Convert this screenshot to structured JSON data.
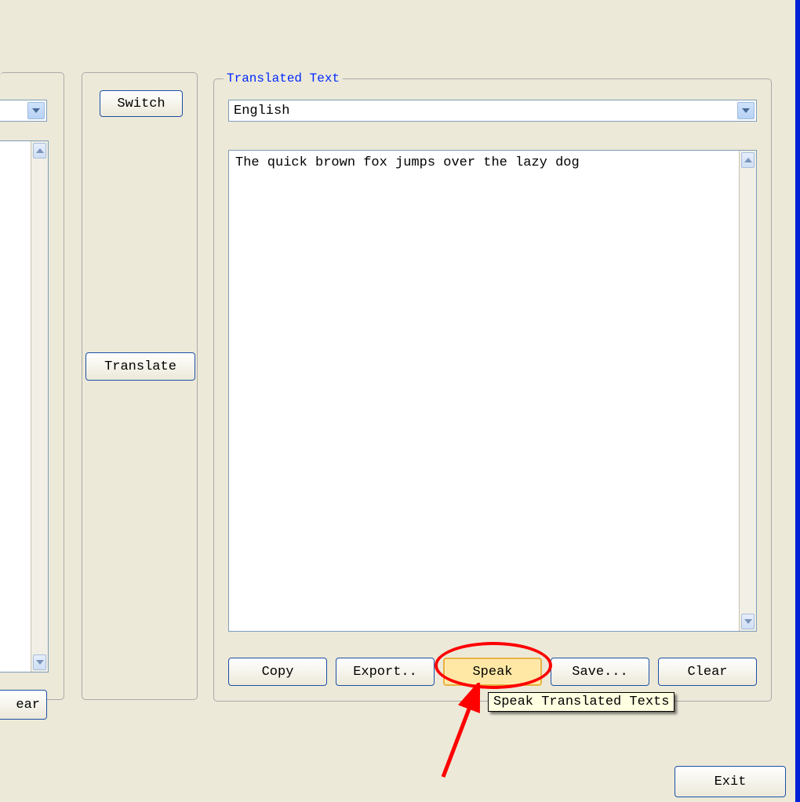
{
  "left": {
    "clear_fragment": "ear"
  },
  "mid": {
    "switch_label": "Switch",
    "translate_label": "Translate"
  },
  "right": {
    "legend": "Translated Text",
    "language": "English",
    "text": "The quick brown fox jumps over the lazy dog",
    "buttons": {
      "copy": "Copy",
      "export": "Export..",
      "speak": "Speak",
      "save": "Save...",
      "clear": "Clear"
    }
  },
  "tooltip": "Speak Translated Texts",
  "footer": {
    "exit": "Exit"
  }
}
